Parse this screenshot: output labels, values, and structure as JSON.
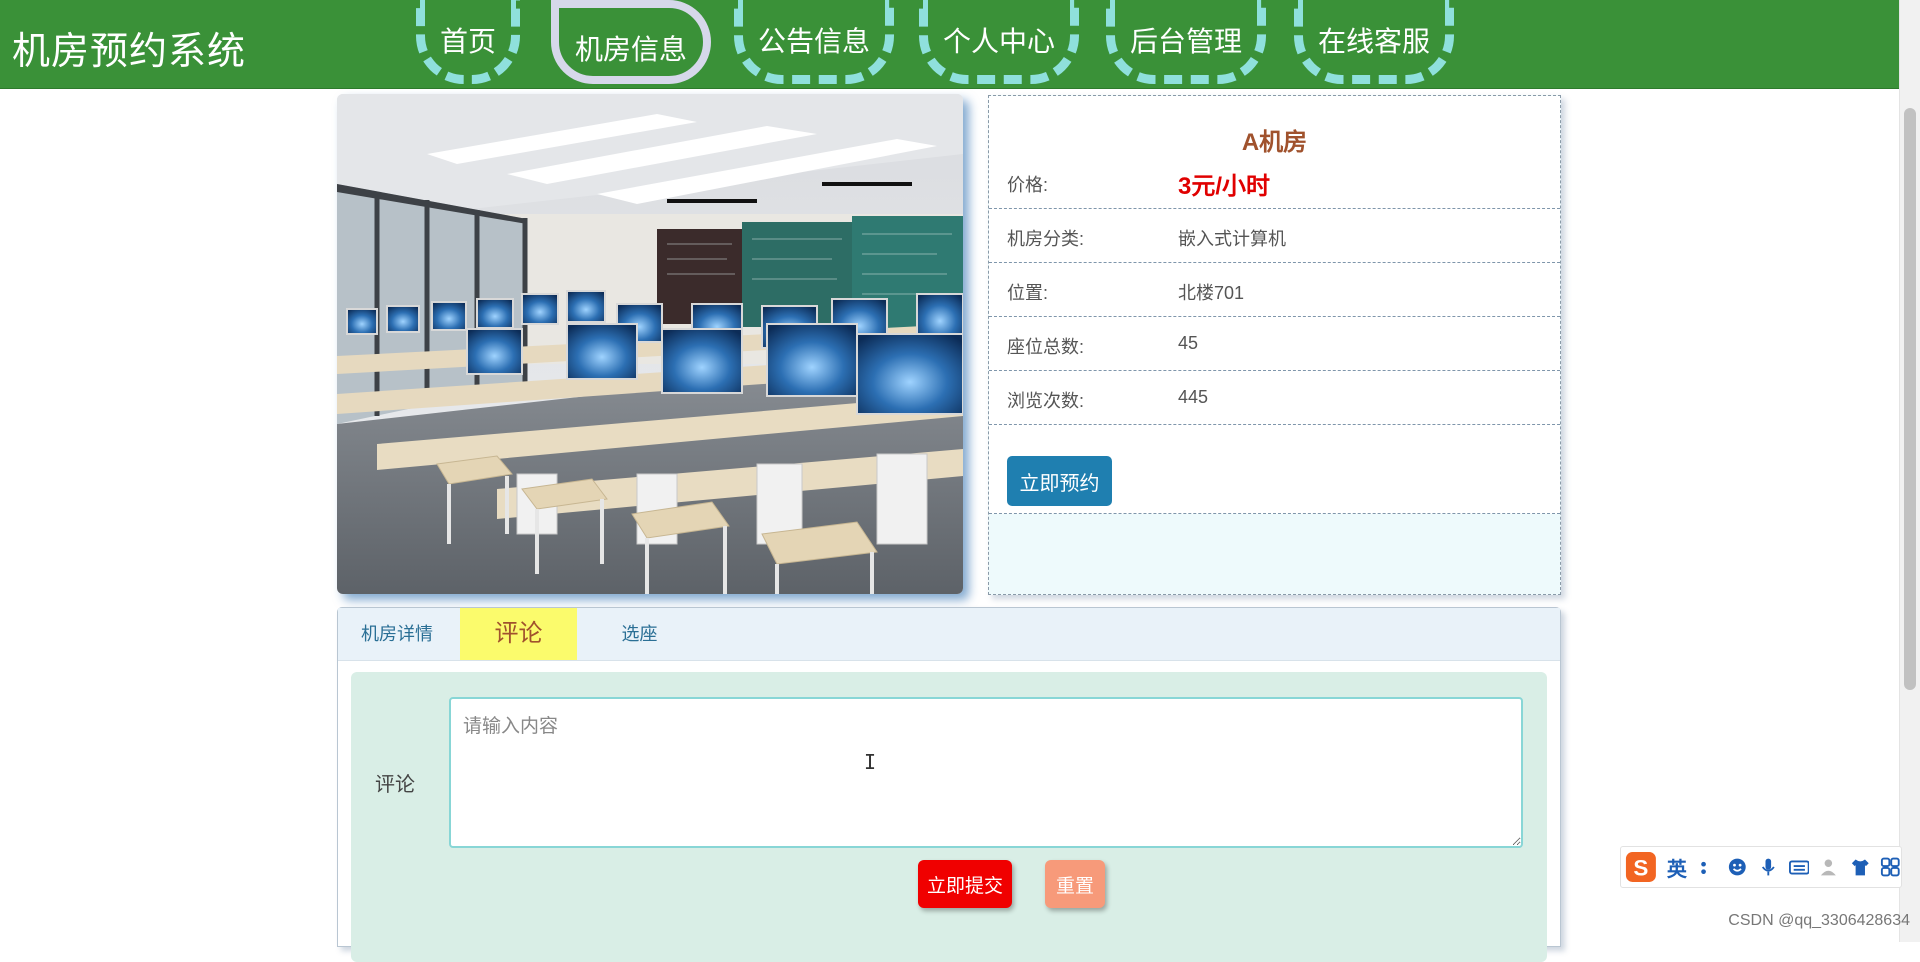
{
  "app": {
    "title": "机房预约系统"
  },
  "nav": {
    "items": [
      {
        "label": "首页",
        "active": false
      },
      {
        "label": "机房信息",
        "active": true
      },
      {
        "label": "公告信息",
        "active": false
      },
      {
        "label": "个人中心",
        "active": false
      },
      {
        "label": "后台管理",
        "active": false
      },
      {
        "label": "在线客服",
        "active": false
      }
    ]
  },
  "room": {
    "name": "A机房",
    "rows": [
      {
        "label": "价格:",
        "value": "3元/小时"
      },
      {
        "label": "机房分类:",
        "value": "嵌入式计算机"
      },
      {
        "label": "位置:",
        "value": "北楼701"
      },
      {
        "label": "座位总数:",
        "value": "45"
      },
      {
        "label": "浏览次数:",
        "value": "445"
      }
    ],
    "book_label": "立即预约"
  },
  "tabs": {
    "items": [
      {
        "label": "机房详情",
        "active": false
      },
      {
        "label": "评论",
        "active": true
      },
      {
        "label": "选座",
        "active": false
      }
    ]
  },
  "comment": {
    "label": "评论",
    "placeholder": "请输入内容",
    "value": "",
    "submit_label": "立即提交",
    "reset_label": "重置"
  },
  "ime": {
    "lang": "英",
    "logo_letter": "S"
  },
  "watermark": "CSDN @qq_3306428634",
  "colors": {
    "header_bg": "#3a9138",
    "nav_border": "#8fe0dc",
    "room_name": "#a0522d",
    "price": "#e00000",
    "book_button": "#1f7fb0",
    "active_tab": "#fbfb6c",
    "submit_button": "#f00000",
    "reset_button": "#f79a7a"
  },
  "icons": [
    "sogou-logo-icon",
    "punctuation-icon",
    "emoji-icon",
    "microphone-icon",
    "keyboard-icon",
    "user-icon",
    "shirt-icon",
    "grid-icon"
  ]
}
